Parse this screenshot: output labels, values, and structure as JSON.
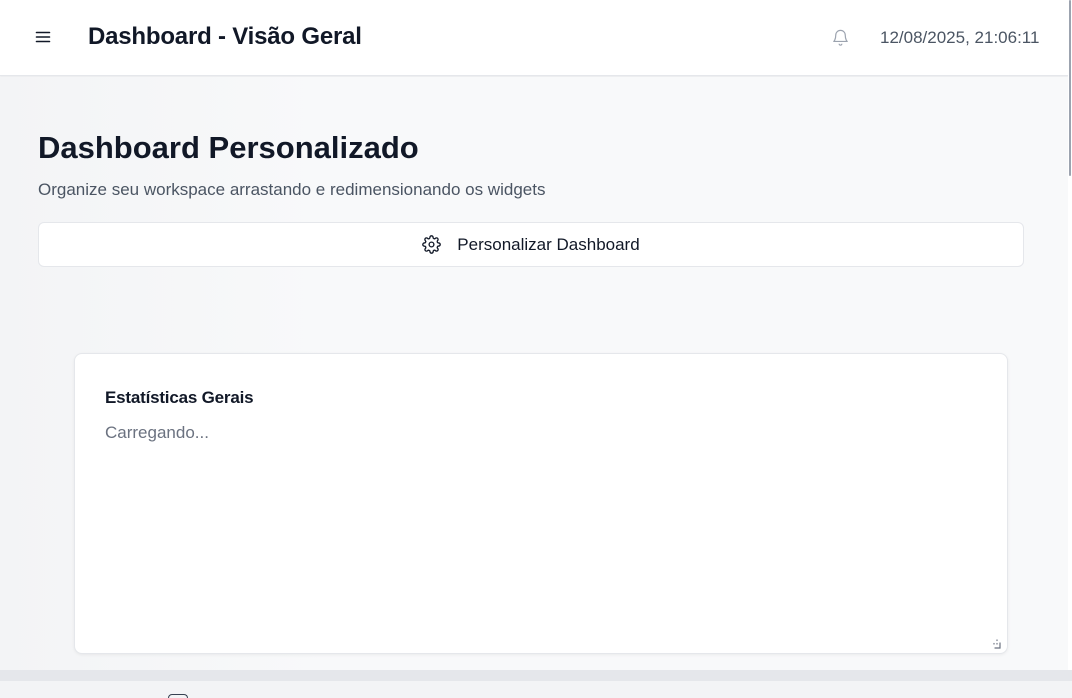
{
  "header": {
    "title": "Dashboard - Visão Geral",
    "datetime": "12/08/2025, 21:06:11",
    "menu_icon": "hamburger-menu-icon",
    "notification_icon": "bell-icon"
  },
  "main": {
    "heading": "Dashboard Personalizado",
    "subtitle": "Organize seu workspace arrastando e redimensionando os widgets",
    "customize_button": {
      "label": "Personalizar Dashboard",
      "icon": "gear-icon"
    }
  },
  "widgets": [
    {
      "title": "Estatísticas Gerais",
      "status": "Carregando..."
    }
  ],
  "colors": {
    "background": "#f3f4f6",
    "surface": "#ffffff",
    "border": "#e5e7eb",
    "text_primary": "#111827",
    "text_secondary": "#4b5563",
    "text_muted": "#6b7280"
  }
}
